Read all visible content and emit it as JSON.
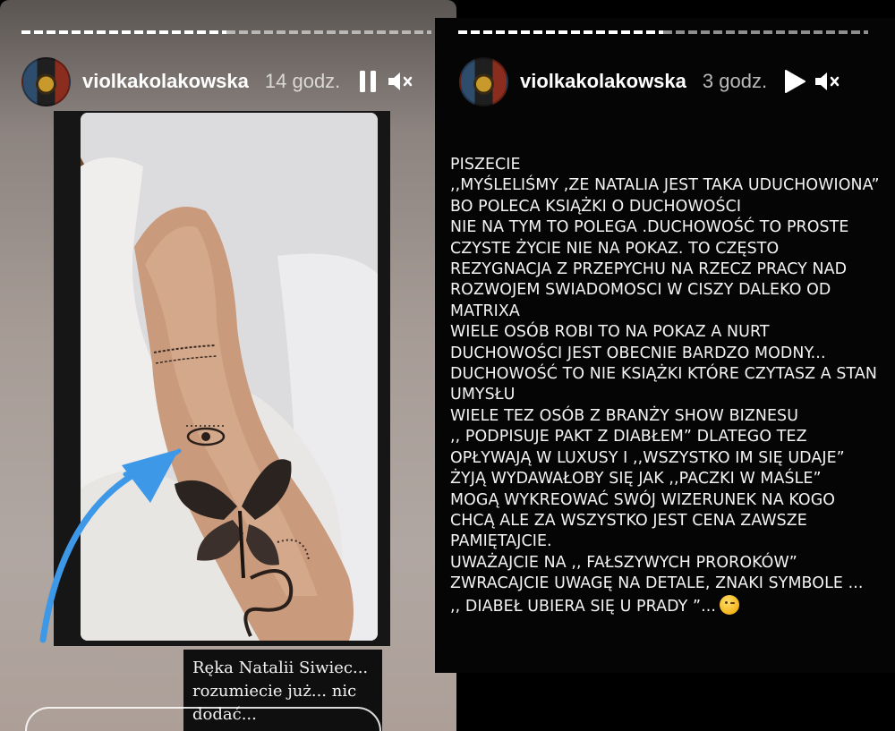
{
  "left_story": {
    "username": "violkakolakowska",
    "time_ago": "14 godz.",
    "caption": "Ręka Natalii Siwiec... rozumiecie już... nic dodać...",
    "progress": {
      "segments": 2,
      "current": 1
    },
    "play_state": "paused",
    "icons": {
      "pause": "pause-icon",
      "mute": "mute-icon",
      "arrow": "arrow-annotation-icon"
    },
    "arrow_color": "#3d98e8"
  },
  "right_story": {
    "username": "violkakolakowska",
    "time_ago": "3 godz.",
    "progress": {
      "segments": 2,
      "current": 1
    },
    "play_state": "playing",
    "icons": {
      "play": "play-icon",
      "mute": "mute-icon",
      "emoji": "winking-face-emoji-icon"
    },
    "text": "PISZECIE\n ,,MYŚLELIŚMY ,ZE NATALIA JEST TAKA UDUCHOWIONA” BO POLECA KSIĄŻKI O DUCHOWOŚCI\nNIE NA TYM TO POLEGA .DUCHOWOŚĆ TO PROSTE CZYSTE ŻYCIE NIE NA POKAZ. TO CZĘSTO REZYGNACJA Z PRZEPYCHU NA RZECZ PRACY NAD ROZWOJEM SWIADOMOSCI W CISZY DALEKO OD MATRIXA\nWIELE OSÓB ROBI TO NA POKAZ A NURT DUCHOWOŚCI JEST OBECNIE BARDZO MODNY...\nDUCHOWOŚĆ TO NIE KSIĄŻKI KTÓRE CZYTASZ A STAN UMYSŁU\nWIELE TEZ OSÓB Z BRANŻY SHOW BIZNESU\n ,, PODPISUJE PAKT Z DIABŁEM” DLATEGO TEZ OPŁYWAJĄ W LUXUSY I ,,WSZYSTKO IM SIĘ UDAJE” ŻYJĄ WYDAWAŁOBY SIĘ JAK ,,PACZKI W MAŚLE”\nMOGĄ WYKREOWAĆ SWÓJ WIZERUNEK NA KOGO CHCĄ ALE ZA WSZYSTKO JEST CENA ZAWSZE PAMIĘTAJCIE.\nUWAŻAJCIE NA ,, FAŁSZYWYCH PROROKÓW”\nZWRACAJCIE UWAGĘ NA DETALE, ZNAKI SYMBOLE ...\n,, DIABEŁ  UBIERA SIĘ U PRADY ”..."
  }
}
